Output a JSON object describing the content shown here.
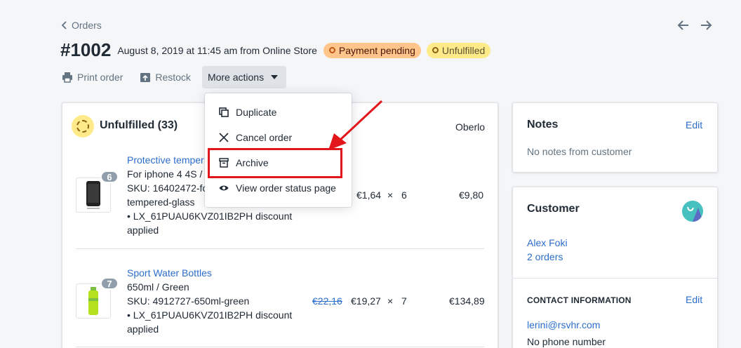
{
  "header": {
    "breadcrumb": "Orders",
    "order_number": "#1002",
    "order_meta": "August 8, 2019 at 11:45 am from Online Store",
    "badges": {
      "payment": "Payment pending",
      "fulfillment": "Unfulfilled"
    }
  },
  "actions": {
    "print": "Print order",
    "restock": "Restock",
    "more": "More actions"
  },
  "dropdown": {
    "items": [
      {
        "label": "Duplicate",
        "icon": "duplicate-icon"
      },
      {
        "label": "Cancel order",
        "icon": "close-icon"
      },
      {
        "label": "Archive",
        "icon": "archive-icon"
      },
      {
        "label": "View order status page",
        "icon": "eye-icon"
      }
    ]
  },
  "fulfillment": {
    "title": "Unfulfilled (33)",
    "supplier": "Oberlo",
    "items": [
      {
        "qty_badge": "6",
        "name": "Protective temper",
        "variant": "For iphone 4 4S /",
        "sku": "SKU: 16402472-fo",
        "sku_cont": "tempered-glass",
        "discount": "• LX_61PUAU6KVZ01IB2PH discount",
        "discount_cont": "applied",
        "price": "€1,64",
        "times": "×",
        "qty": "6",
        "total": "€9,80"
      },
      {
        "qty_badge": "7",
        "name": "Sport Water Bottles",
        "variant": "650ml / Green",
        "sku": "SKU: 4912727-650ml-green",
        "discount": "• LX_61PUAU6KVZ01IB2PH discount",
        "discount_cont": "applied",
        "original_price": "€22,16",
        "price": "€19,27",
        "times": "×",
        "qty": "7",
        "total": "€134,89"
      }
    ]
  },
  "notes": {
    "title": "Notes",
    "edit": "Edit",
    "text": "No notes from customer"
  },
  "customer": {
    "title": "Customer",
    "name": "Alex Foki",
    "orders": "2 orders",
    "contact_label": "CONTACT INFORMATION",
    "edit": "Edit",
    "email": "lerini@rsvhr.com",
    "phone": "No phone number"
  },
  "colors": {
    "link": "#2c6ecb",
    "payment_badge": "#ffc58b",
    "fulfillment_badge": "#ffea8a",
    "annotation": "#e2161b"
  }
}
